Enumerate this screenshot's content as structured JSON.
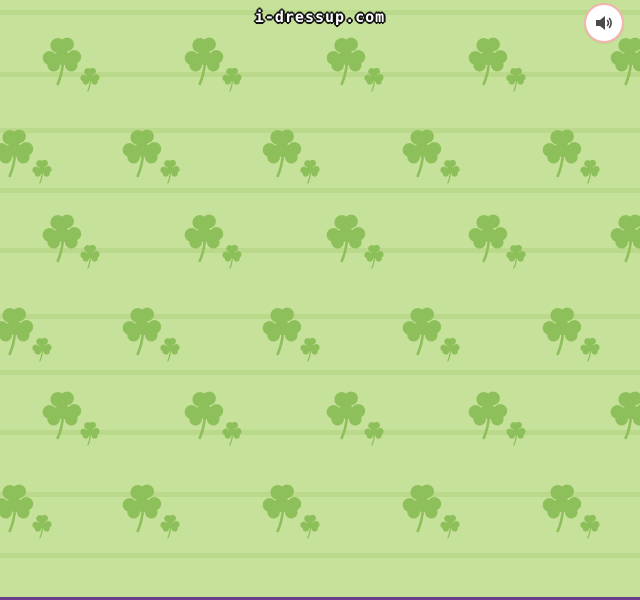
{
  "site": {
    "logo_text": "i-dressup.com"
  },
  "sound_button": {
    "icon": "speaker-icon",
    "state": "on"
  },
  "colors": {
    "background": "#c6e29a",
    "stripe": "#bad98a",
    "clover": "#8dbf5a",
    "bottom_bar": "#6b3e8c",
    "sound_ring": "#f4b3ad",
    "speaker": "#4a4a4a"
  },
  "background_pattern": {
    "motif": "shamrock-icon"
  }
}
